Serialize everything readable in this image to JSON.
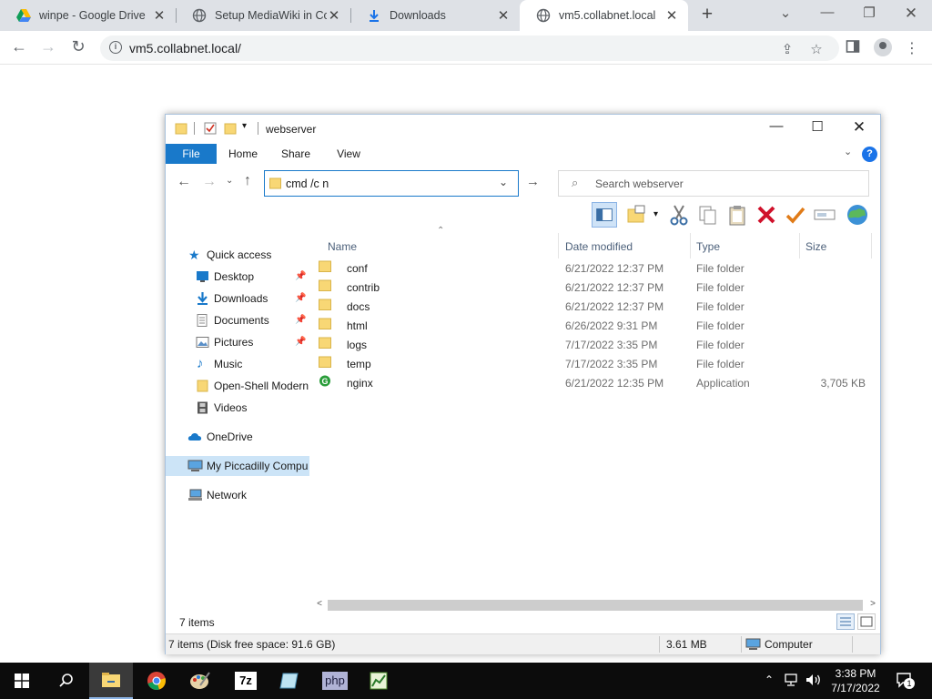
{
  "browser": {
    "tabs": [
      {
        "title": "winpe - Google Drive"
      },
      {
        "title": "Setup MediaWiki in Co"
      },
      {
        "title": "Downloads"
      },
      {
        "title": "vm5.collabnet.local"
      }
    ],
    "address": "vm5.collabnet.local/"
  },
  "explorer": {
    "title": "webserver",
    "ribbon_tabs": [
      "File",
      "Home",
      "Share",
      "View"
    ],
    "address_value": "cmd /c n",
    "search_placeholder": "Search webserver",
    "nav": [
      {
        "label": "Quick access"
      },
      {
        "label": "Desktop",
        "pinned": true
      },
      {
        "label": "Downloads",
        "pinned": true
      },
      {
        "label": "Documents",
        "pinned": true
      },
      {
        "label": "Pictures",
        "pinned": true
      },
      {
        "label": "Music"
      },
      {
        "label": "Open-Shell Modern"
      },
      {
        "label": "Videos"
      },
      {
        "label": "OneDrive"
      },
      {
        "label": "My Piccadilly Compu"
      },
      {
        "label": "Network"
      }
    ],
    "columns": {
      "name": "Name",
      "date": "Date modified",
      "type": "Type",
      "size": "Size"
    },
    "files": [
      {
        "name": "conf",
        "date": "6/21/2022 12:37 PM",
        "type": "File folder",
        "size": ""
      },
      {
        "name": "contrib",
        "date": "6/21/2022 12:37 PM",
        "type": "File folder",
        "size": ""
      },
      {
        "name": "docs",
        "date": "6/21/2022 12:37 PM",
        "type": "File folder",
        "size": ""
      },
      {
        "name": "html",
        "date": "6/26/2022 9:31 PM",
        "type": "File folder",
        "size": ""
      },
      {
        "name": "logs",
        "date": "7/17/2022 3:35 PM",
        "type": "File folder",
        "size": ""
      },
      {
        "name": "temp",
        "date": "7/17/2022 3:35 PM",
        "type": "File folder",
        "size": ""
      },
      {
        "name": "nginx",
        "date": "6/21/2022 12:35 PM",
        "type": "Application",
        "size": "3,705 KB"
      }
    ],
    "status_items": "7 items",
    "details_items": "7 items (Disk free space: 91.6 GB)",
    "details_size": "3.61 MB",
    "details_location": "Computer"
  },
  "taskbar": {
    "time": "3:38 PM",
    "date": "7/17/2022",
    "notification_count": "1",
    "php_label": "php"
  },
  "colors": {
    "file_tab": "#1979ca",
    "folder": "#f8d775",
    "selection": "#cce4f7"
  }
}
